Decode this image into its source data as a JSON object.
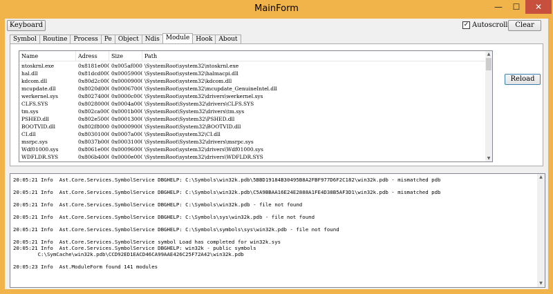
{
  "window": {
    "title": "MainForm",
    "minimize_glyph": "—",
    "maximize_glyph": "☐",
    "close_glyph": "✕"
  },
  "toolbar": {
    "keyboard_label": "Keyboard",
    "autoscroll_label": "Autoscroll",
    "autoscroll_checked": "✓",
    "clear_label": "Clear"
  },
  "tabs": [
    {
      "label": "Symbol"
    },
    {
      "label": "Routine"
    },
    {
      "label": "Process"
    },
    {
      "label": "Pe"
    },
    {
      "label": "Object"
    },
    {
      "label": "Ndis"
    },
    {
      "label": "Module"
    },
    {
      "label": "Hook"
    },
    {
      "label": "About"
    }
  ],
  "module_tab": {
    "reload_label": "Reload",
    "columns": [
      "Name",
      "Adress",
      "Size",
      "Path"
    ],
    "rows": [
      [
        "ntoskrnl.exe",
        "0x8181e000",
        "0x005af000",
        "\\SystemRoot\\system32\\ntoskrnl.exe"
      ],
      [
        "hal.dll",
        "0x81dcd000",
        "0x00059000",
        "\\SystemRoot\\system32\\halmacpi.dll"
      ],
      [
        "kdcom.dll",
        "0x80d2c000",
        "0x00009000",
        "\\SystemRoot\\system32\\kdcom.dll"
      ],
      [
        "mcupdate.dll",
        "0x8020d000",
        "0x00067000",
        "\\SystemRoot\\system32\\mcupdate_GenuineIntel.dll"
      ],
      [
        "werkernel.sys",
        "0x80274000",
        "0x0000c000",
        "\\SystemRoot\\system32\\drivers\\werkernel.sys"
      ],
      [
        "CLFS.SYS",
        "0x80280000",
        "0x0004a000",
        "\\SystemRoot\\System32\\drivers\\CLFS.SYS"
      ],
      [
        "tm.sys",
        "0x802ca000",
        "0x0001b000",
        "\\SystemRoot\\System32\\drivers\\tm.sys"
      ],
      [
        "PSHED.dll",
        "0x802e5000",
        "0x00013000",
        "\\SystemRoot\\System32\\PSHED.dll"
      ],
      [
        "BOOTVID.dll",
        "0x802f8000",
        "0x00009000",
        "\\SystemRoot\\System32\\BOOTVID.dll"
      ],
      [
        "CI.dll",
        "0x80301000",
        "0x0007a000",
        "\\SystemRoot\\system32\\CI.dll"
      ],
      [
        "msrpc.sys",
        "0x8037b000",
        "0x00031000",
        "\\SystemRoot\\System32\\drivers\\msrpc.sys"
      ],
      [
        "Wdf01000.sys",
        "0x8061e000",
        "0x00096000",
        "\\SystemRoot\\system32\\drivers\\Wdf01000.sys"
      ],
      [
        "WDFLDR.SYS",
        "0x806b4000",
        "0x0000e000",
        "\\SystemRoot\\system32\\drivers\\WDFLDR.SYS"
      ]
    ]
  },
  "log": {
    "lines": [
      "20:05:21 Info  Ast.Core.Services.SymbolService DBGHELP: C:\\Symbols\\win32k.pdb\\5BBD19184B30495B8A2FBF977D6F2C182\\win32k.pdb - mismatched pdb",
      "",
      "20:05:21 Info  Ast.Core.Services.SymbolService DBGHELP: C:\\Symbols\\win32k.pdb\\C5A9BBAA16E24E2888A1FE4D38B5AF3D1\\win32k.pdb - mismatched pdb",
      "",
      "20:05:21 Info  Ast.Core.Services.SymbolService DBGHELP: C:\\Symbols\\win32k.pdb - file not found",
      "",
      "20:05:21 Info  Ast.Core.Services.SymbolService DBGHELP: C:\\Symbols\\sys\\win32k.pdb - file not found",
      "",
      "20:05:21 Info  Ast.Core.Services.SymbolService DBGHELP: C:\\Symbols\\symbols\\sys\\win32k.pdb - file not found",
      "",
      "20:05:21 Info  Ast.Core.Services.SymbolService symbol Load has completed for win32k.sys",
      "20:05:21 Info  Ast.Core.Services.SymbolService DBGHELP: win32k - public symbols",
      "        C:\\SymCache\\win32k.pdb\\CCD92ED1EACD46CA99AAE426C25F72A42\\win32k.pdb",
      "",
      "20:05:23 Info  Ast.ModuleForm found 141 modules"
    ]
  },
  "colors": {
    "window_frame": "#f0b44a",
    "close_button": "#c74f3e",
    "client_bg": "#f0f0f0"
  }
}
